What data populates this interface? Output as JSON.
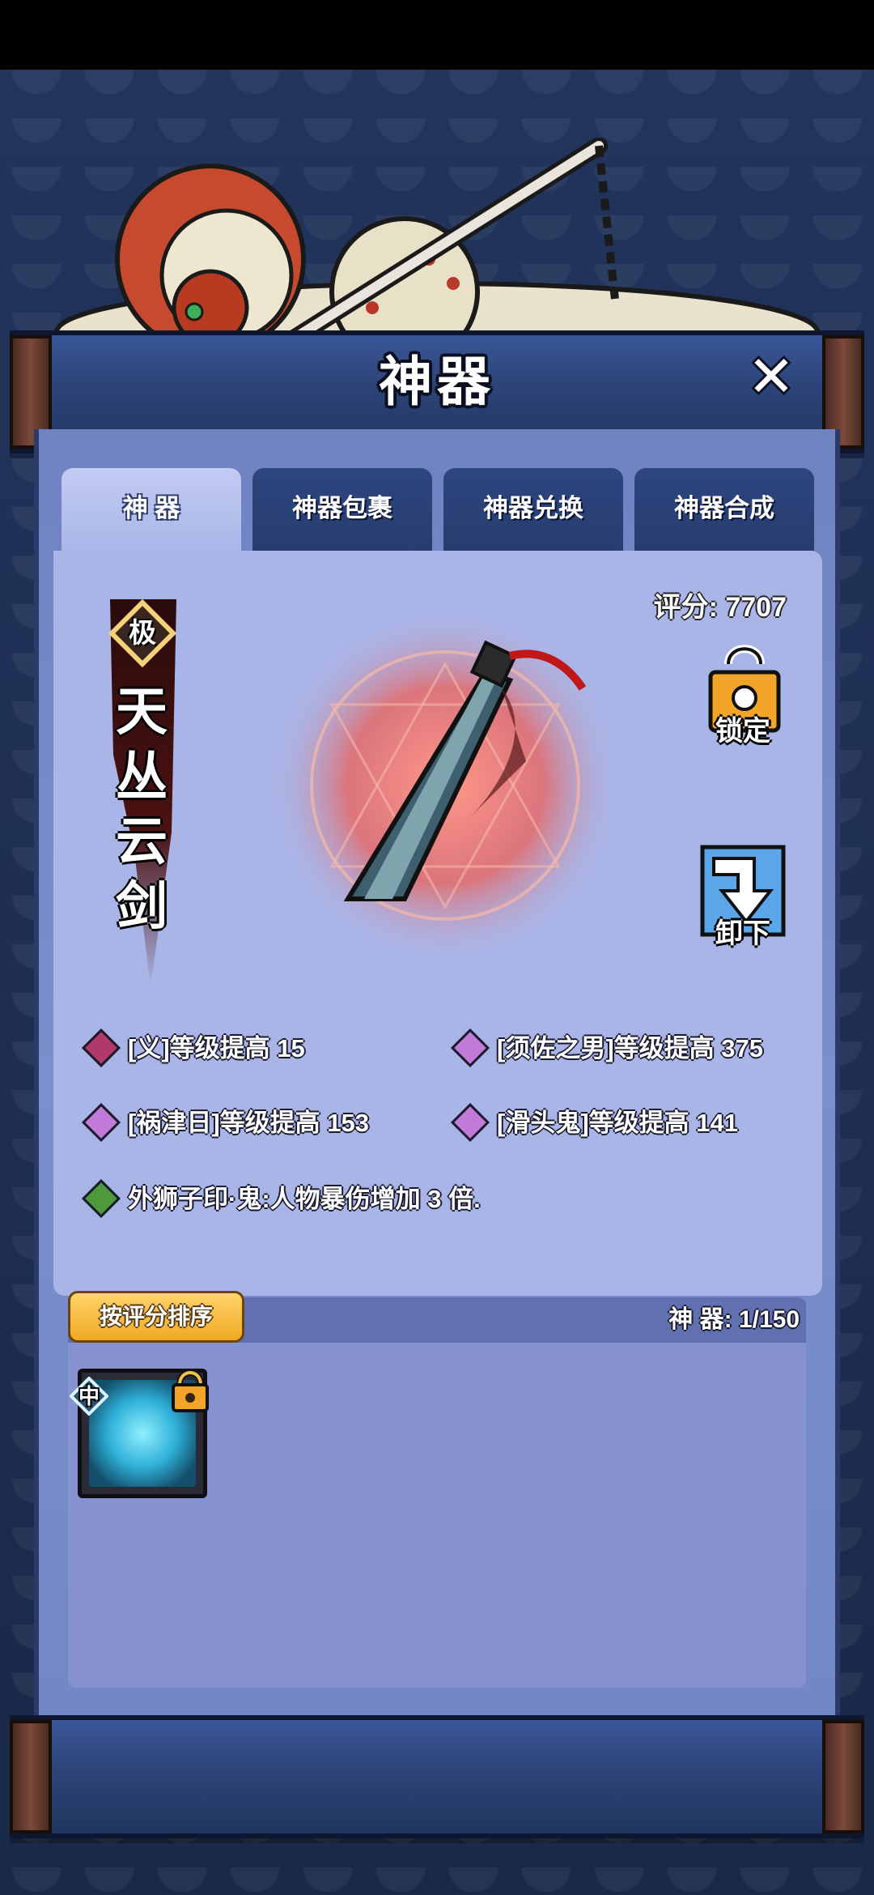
{
  "window": {
    "title": "神器",
    "close_label": "✕"
  },
  "tabs": [
    {
      "label": "神 器",
      "active": true
    },
    {
      "label": "神器包裹",
      "active": false
    },
    {
      "label": "神器兑换",
      "active": false
    },
    {
      "label": "神器合成",
      "active": false
    }
  ],
  "artifact": {
    "grade": "极",
    "name": "天丛云剑",
    "score_label": "评分:",
    "score_value": "7707",
    "icon": "sword-icon"
  },
  "actions": {
    "lock_label": "锁定",
    "unequip_label": "卸下"
  },
  "attributes": [
    {
      "text": "[义]等级提高 15",
      "gem_color": "#b0386a"
    },
    {
      "text": "[须佐之男]等级提高 375",
      "gem_color": "#c27ad8"
    },
    {
      "text": "[祸津日]等级提高 153",
      "gem_color": "#c27ad8"
    },
    {
      "text": "[滑头鬼]等级提高 141",
      "gem_color": "#c27ad8"
    },
    {
      "text": "外狮子印·鬼:人物暴伤增加 3 倍.",
      "gem_color": "#4e9a3a"
    }
  ],
  "inventory": {
    "sort_label": "按评分排序",
    "count_text": "神 器: 1/150",
    "items": [
      {
        "grade": "中",
        "icon": "artifact-scroll-icon",
        "locked": true
      }
    ]
  },
  "colors": {
    "background": "#1d2c4e",
    "panel": "#aab5e7",
    "accent": "#f0a922"
  }
}
